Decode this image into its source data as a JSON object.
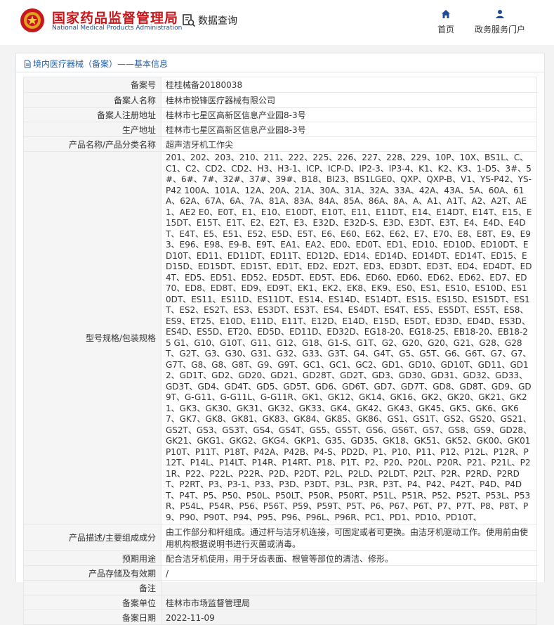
{
  "header": {
    "brand_cn": "国家药品监督管理局",
    "brand_en": "National Medical Products Administration",
    "data_query": "数据查询",
    "nav_home": "首页",
    "nav_portal": "政务服务门户",
    "brand_color": "#c5171c",
    "icons": [
      "emblem-icon",
      "search-doc-icon",
      "home-icon",
      "user-icon"
    ]
  },
  "breadcrumb": {
    "text": "境内医疗器械（备案）——基本信息",
    "icon": "document-icon"
  },
  "rows": [
    {
      "label": "备案号",
      "value": "桂桂械备20180038"
    },
    {
      "label": "备案人名称",
      "value": "桂林市锐锋医疗器械有限公司"
    },
    {
      "label": "备案人注册地址",
      "value": "桂林市七星区高新区信息产业园8-3号"
    },
    {
      "label": "生产地址",
      "value": "桂林市七星区高新区信息产业园8-3号"
    },
    {
      "label": "产品名称/产品分类名称",
      "value": "超声洁牙机工作尖"
    },
    {
      "label": "型号规格/包装规格",
      "value": "201、202、203、210、211、222、225、226、227、228、229、10P、10X、BS1L、C、C1、C2、CD2、CD2、H3、H3-1、ICP、ICP-D、IP2-3、IP3-4、K1、K2、K3、1-D5、3#、5#、6#、7#、32#、37#、39#、B18、BI23、BS1LGE0、QXP、QXP-B、V1、YS-P42、YS-P42 100A、101A、12A、20A、21A、30A、31A、32A、33A、42A、43A、5A、60A、61A、62A、67A、6A、7A、81A、83A、84A、85A、86A、8A、A、A1、A1T、A2、A2T、AE1、AE2 E0、E0T、E1、E10、E10DT、E10T、E11、E11DT、E14、E14DT、E14T、E15、E15DT、E15T、E1T、E2、E2T、E3、E32D、E32D-S、E3D、E3DT、E3T、E4、E4D、E4DT、E4T、E5、E51、E52、E5D、E5T、E6、E60、E62、E62、E7、E70、E8、E8T、E9、E93、E96、E98、E9-B、E9T、EA1、EA2、ED0、ED0T、ED1、ED10、ED10D、ED10DT、ED10T、ED11、ED11DT、ED11T、ED12D、ED14、ED14D、ED14DT、ED14T、ED15、ED15D、ED15DT、ED15T、ED1T、ED2、ED2T、ED3、ED3DT、ED3T、ED4、ED4DT、ED4T、ED5、ED51、ED52、ED5DT、ED5T、ED6、ED60、ED60、ED62、ED62、ED7、ED70、ED8、ED8T、ED9、ED9T、EK1、EK2、EK8、EK9、ES0、ES1、ES10、ES10D、ES10DT、ES11、ES11D、ES11DT、ES14、ES14D、ES14DT、ES15、ES15D、ES15DT、ES1T、ES2、ES2T、ES3、ES3DT、ES3T、ES4、ES4DT、ES4T、ES5、ES5DT、ES5T、ES8、ES9、ET25、E10D、E11D、E11T、E12D、E14D、E15D、E5DT、ED3D、ED4D、ES3D、ES4D、ES5D、ET20、ED5D、ED11D、ED32D、EG18-20、EG18-25、EB18-20、EB18-25 G1、G10、G10T、G11、G12、G18、G1-S、G1T、G2、G20、G20、G21、G28、G28T、G2T、G3、G30、G31、G32、G33、G3T、G4、G4T、G5、G5T、G6、G6T、G7、G7、G7T、G8、G8、G8T、G9、G9T、GC1、GC1、GC2、GD1、GD10、GD10T、GD11、GD12、GD1T、GD2、GD20、GD21、GD28T、GD2T、GD3、GD30、GD31、GD32、GD33、GD3T、GD4、GD4T、GD5、GD5T、GD6、GD6T、GD7、GD7T、GD8、GD8T、GD9、GD9T、G-G11、G-G11L、G-G11R、GK1、GK12、GK14、GK16、GK2、GK20、GK21、GK21、GK3、GK30、GK31、GK32、GK33、GK4、GK42、GK43、GK45、GK5、GK6、GK67、GK7、GK8、GK81、GK83、GK84、GK85、GK86、GS1、GS1T、GS2、GS20、GS21、GS2T、GS3、GS3T、GS4、GS4T、GS5、GS5T、GS6、GS6T、GS7、GS8、GS9、GD28、GK21、GKG1、GKG2、GKG4、GKP1、G35、GD35、GK18、GK51、GK52、GK00、GK01 P10T、P11T、P18T、P42A、P42B、P4-S、PD2D、P1、P10、P11、P12、P12L、P12R、P12T、P14L、P14LT、P14R、P14RT、P18、P1T、P2、P20、P20L、P20R、P21、P21L、P21R、P22、P22L、P22R、P2D、P2DT、P2L、P2LD、P2LDT、P2LT、P2R、P2RD、P2RDT、P2RT、P3、P3-1、P33、P3D、P3DT、P3L、P3R、P3T、P4、P42、P42T、P4D、P4DT、P4T、P5、P50、P50L、P50LT、P50R、P50RT、P51L、P51R、P52、P52T、P53L、P53R、P54L、P54R、P56、P56T、P59、P59T、P5T、P6、P67、P6T、P7、P7T、P8、P8T、P9、P90、P90T、P94、P95、P96、P96L、P96R、PC1、PD1、PD10、PD10T、"
    },
    {
      "label": "产品描述/主要组成成分",
      "value": "由工作部分和杆组成。通过杆与洁牙机连接，可固定或者可更换。由洁牙机驱动工作。使用前由使用机构根据说明书进行灭菌或消毒。"
    },
    {
      "label": "预期用途",
      "value": "配合洁牙机使用，用于牙齿表面、根管等部位的清洁、修形。"
    },
    {
      "label": "产品存储及有效期",
      "value": "/"
    },
    {
      "label": "备注",
      "value": ""
    },
    {
      "label": "备案单位",
      "value": "桂林市市场监督管理局"
    },
    {
      "label": "备案日期",
      "value": "2022-11-09"
    }
  ]
}
